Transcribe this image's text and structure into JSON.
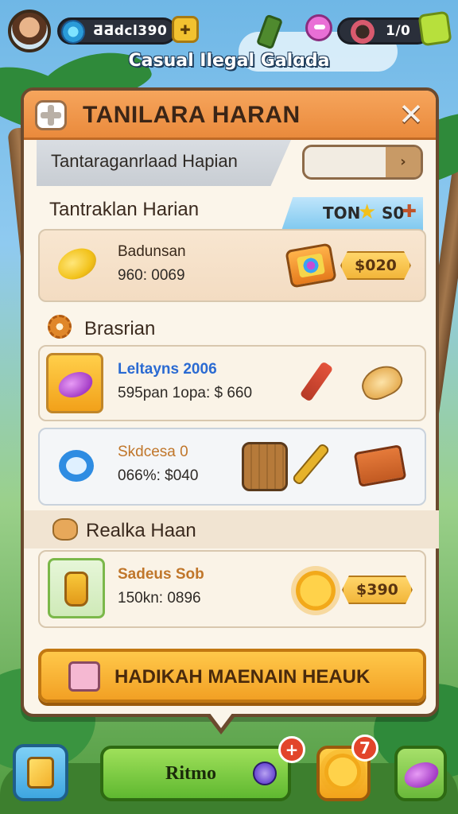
{
  "topbar": {
    "currency_value": "ƋƋdcl390",
    "energy_value": "1/0"
  },
  "game_title": "Casual Ilegal Galɑda",
  "panel": {
    "title": "TANILARA HARAN",
    "subtitle": "Tantaraganrlaad Hapian",
    "search_placeholder": "",
    "section_daily": "Tantraklan Harian",
    "ton_label": "TON",
    "ton_value": "S0",
    "section_bonus": "Brasrian",
    "section_reward": "Realka Haan",
    "cta_label": "HADIKAH MAENAIN HEAUK"
  },
  "items": [
    {
      "name": "Badunsan",
      "sub": "960: 0069",
      "price": "$020"
    },
    {
      "name": "Leltayns 2006",
      "sub": "595pan 1opa: $ 660"
    },
    {
      "name": "Skdcesa 0",
      "sub": "066%: $040"
    },
    {
      "name": "Sadeus Sob",
      "sub": "150kn: 0896",
      "price": "$390"
    }
  ],
  "bottom": {
    "main_label": "Ritmo",
    "badge_main": "+",
    "badge_sun": "7"
  },
  "colors": {
    "header_orange": "#ea8a3c",
    "panel_bg": "#fbf5ea",
    "cta_yellow": "#f2a024",
    "main_green": "#5fb830",
    "price_gold": "#f2b63a"
  },
  "icons": {
    "avatar": "player-avatar",
    "close": "close-icon",
    "header": "plus-icon",
    "section_bonus": "gear-icon",
    "section_reward": "cookie-icon"
  }
}
